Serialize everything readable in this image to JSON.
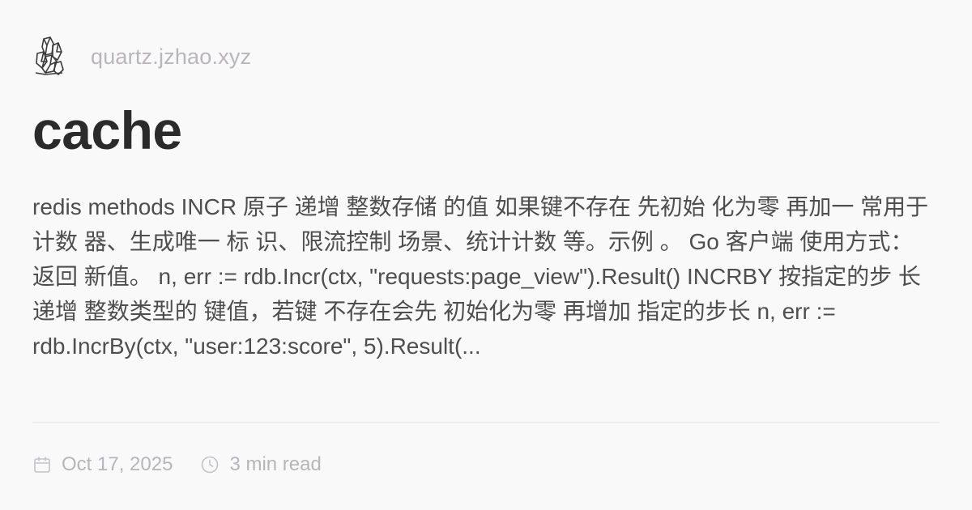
{
  "site": {
    "logo_icon": "crystal-logo-icon",
    "domain": "quartz.jzhao.xyz"
  },
  "page": {
    "title": "cache",
    "excerpt": "redis methods INCR 原子 递增 整数存储 的值 如果键不存在 先初始 化为零 再加一 常用于计数 器、生成唯一 标 识、限流控制 场景、统计计数 等。示例 。 Go 客户端 使用方式：\n返回 新值。 n, err := rdb.Incr(ctx, \"requests:page_view\").Result() INCRBY 按指定的步 长递增 整数类型的 键值，若键 不存在会先 初始化为零 再增加 指定的步长 n, err := rdb.IncrBy(ctx, \"user:123:score\", 5).Result(..."
  },
  "meta": {
    "date": "Oct 17, 2025",
    "date_icon": "calendar-icon",
    "reading_time": "3 min read",
    "reading_time_icon": "clock-icon"
  },
  "colors": {
    "background": "#faf9fa",
    "title": "#2b2b2b",
    "body_text": "#4e4e4e",
    "muted": "#b7b5ba",
    "divider": "#e7e5e8"
  }
}
